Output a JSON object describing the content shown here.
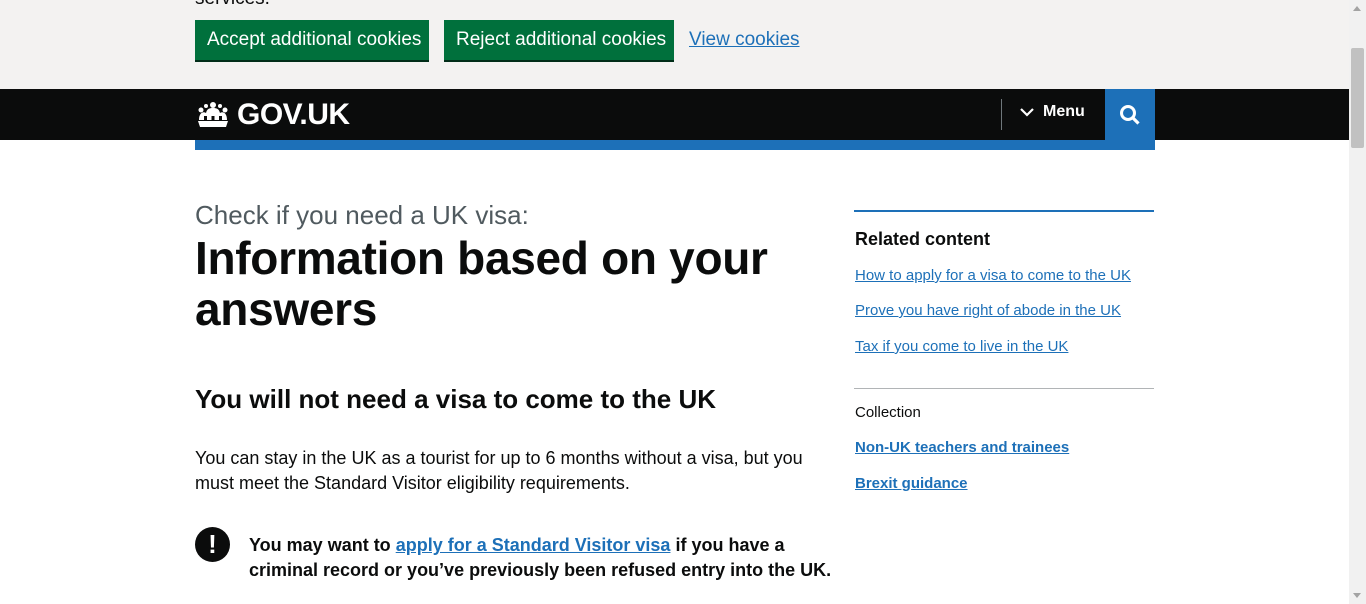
{
  "cookie_banner": {
    "cut_text": "services.",
    "accept_label": "Accept additional cookies",
    "reject_label": "Reject additional cookies",
    "view_label": "View cookies"
  },
  "header": {
    "logo_text": "GOV.UK",
    "menu_label": "Menu",
    "search_icon": "search-icon"
  },
  "main": {
    "caption": "Check if you need a UK visa:",
    "title": "Information based on your answers",
    "subheading": "You will not need a visa to come to the UK",
    "body": "You can stay in the UK as a tourist for up to 6 months without a visa, but you must meet the Standard Visitor eligibility requirements.",
    "warning": {
      "icon": "!",
      "prefix": "You may want to ",
      "link": "apply for a Standard Visitor visa",
      "suffix": " if you have a criminal record or you’ve previously been refused entry into the UK."
    }
  },
  "sidebar": {
    "heading": "Related content",
    "links": [
      "How to apply for a visa to come to the UK",
      "Prove you have right of abode in the UK",
      "Tax if you come to live in the UK"
    ],
    "collection_label": "Collection",
    "collection_links": [
      "Non-UK teachers and trainees",
      "Brexit guidance"
    ]
  },
  "colors": {
    "green": "#00703c",
    "blue": "#1d70b8",
    "black": "#0b0c0c",
    "banner_bg": "#f3f2f1"
  }
}
